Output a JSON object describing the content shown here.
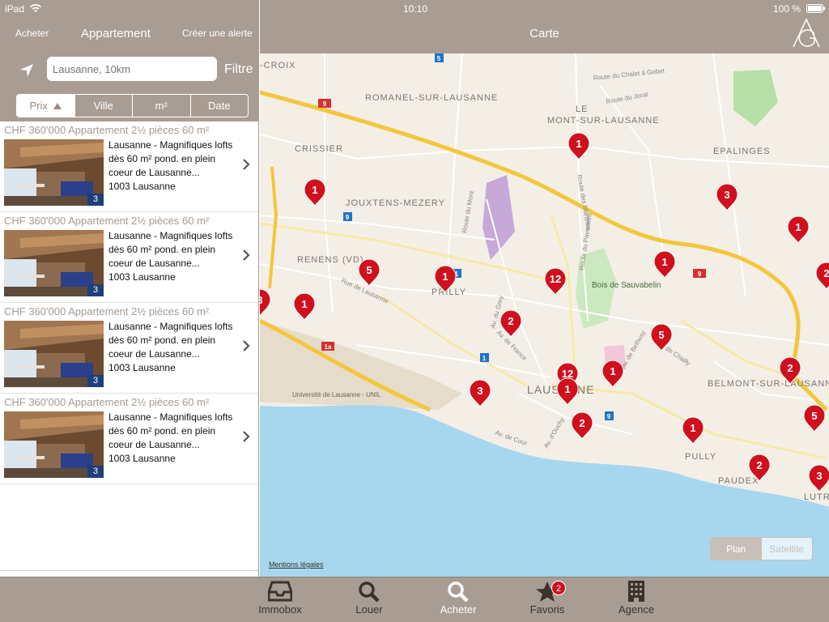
{
  "status_bar": {
    "device": "iPad",
    "time": "10:10",
    "battery": "100 %"
  },
  "left_nav": {
    "back_label": "Acheter",
    "title": "Appartement",
    "alert_label": "Créer une alerte"
  },
  "search": {
    "placeholder": "Lausanne, 10km",
    "filter_label": "Filtre"
  },
  "sort": {
    "options": [
      "Prix",
      "Ville",
      "m²",
      "Date"
    ],
    "active": "Prix"
  },
  "listings": [
    {
      "price_line": "CHF 360'000 Appartement 2½ pièces 60 m²",
      "title": "Lausanne - Magnifiques lofts dès 60 m² pond. en plein coeur de Lausanne...",
      "location": "1003 Lausanne",
      "photo_count": "3"
    },
    {
      "price_line": "CHF 360'000 Appartement 2½ pièces 60 m²",
      "title": "Lausanne - Magnifiques lofts dès 60 m² pond. en plein coeur de Lausanne...",
      "location": "1003 Lausanne",
      "photo_count": "3"
    },
    {
      "price_line": "CHF 360'000 Appartement 2½ pièces 60 m²",
      "title": "Lausanne - Magnifiques lofts dès 60 m² pond. en plein coeur de Lausanne...",
      "location": "1003 Lausanne",
      "photo_count": "3"
    },
    {
      "price_line": "CHF 360'000 Appartement 2½ pièces 60 m²",
      "title": "Lausanne - Magnifiques lofts dès 60 m² pond. en plein coeur de Lausanne...",
      "location": "1003 Lausanne",
      "photo_count": "3"
    }
  ],
  "map": {
    "title": "Carte",
    "logo": "AG-logo",
    "mentions": "Mentions légales",
    "view_modes": [
      "Plan",
      "Satellite"
    ],
    "active_view": "Plan",
    "place_labels": [
      "ROMANEL-SUR-LAUSANNE",
      "MONT-SUR-LAUSANNE",
      "CRISSIER",
      "JOUXTENS-MEZERY",
      "EPALINGES",
      "RENENS (VD)",
      "PRILLY",
      "LAUSANNE",
      "BELMONT-SUR-LAUSANNE",
      "PULLY",
      "PAUDEX",
      "LUTRY",
      "Bois de Sauvabelin",
      "Université de Lausanne - UNIL",
      "-CROIX",
      "LE"
    ],
    "road_labels": [
      "Route du Chalet à Gobet",
      "Route du Jorat",
      "Route des Martines",
      "Route du Pavement",
      "Route du Mont",
      "Rue de Lausanne",
      "Av. du Grey",
      "Av. de France",
      "Av. de Bethusy",
      "Av. de Chailly",
      "Av. de Cour",
      "Av. d'Ouchy"
    ],
    "route_shields": [
      "9",
      "9",
      "9",
      "9",
      "1",
      "1a",
      "1",
      "5"
    ],
    "markers": [
      "1",
      "1",
      "3",
      "1",
      "5",
      "1",
      "12",
      "1",
      "3",
      "1",
      "2",
      "5",
      "2",
      "12",
      "1",
      "1",
      "3",
      "2",
      "1",
      "5",
      "2",
      "3",
      "2"
    ]
  },
  "tabbar": {
    "items": [
      {
        "label": "Immobox",
        "icon": "inbox-icon"
      },
      {
        "label": "Louer",
        "icon": "search-icon"
      },
      {
        "label": "Acheter",
        "icon": "search-icon"
      },
      {
        "label": "Favoris",
        "icon": "star-icon",
        "badge": "2"
      },
      {
        "label": "Agence",
        "icon": "building-icon"
      }
    ],
    "active": "Acheter"
  },
  "colors": {
    "header_bg": "#a99c92",
    "marker": "#d0101d",
    "water": "#a6d7ee",
    "motorway": "#f4c63c"
  }
}
